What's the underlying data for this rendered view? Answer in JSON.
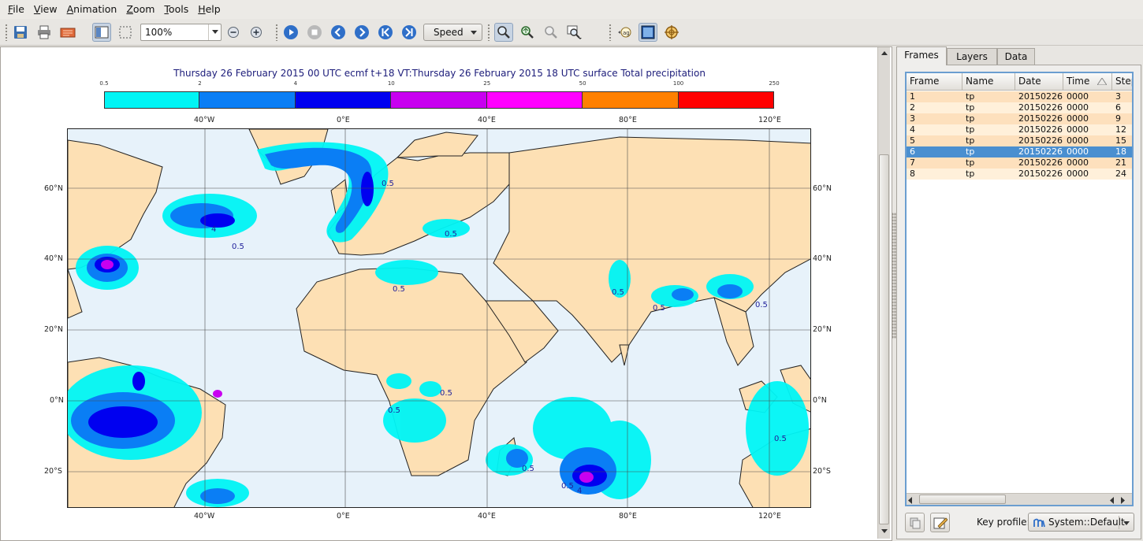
{
  "menu": [
    "File",
    "View",
    "Animation",
    "Zoom",
    "Tools",
    "Help"
  ],
  "toolbar": {
    "zoom_value": "100%",
    "speed_label": "Speed"
  },
  "plot": {
    "title": "Thursday 26 February 2015 00 UTC ecmf t+18 VT:Thursday 26 February 2015 18 UTC surface  Total precipitation",
    "legend": {
      "labels": [
        "0.5",
        "2",
        "4",
        "10",
        "25",
        "50",
        "100",
        "250"
      ],
      "colors": [
        "#00f5f5",
        "#0a7ef5",
        "#0000f0",
        "#c800f0",
        "#ff00ff",
        "#ff8000",
        "#ff0000"
      ]
    },
    "lon_labels": [
      "40°W",
      "0°E",
      "40°E",
      "80°E",
      "120°E"
    ],
    "lat_labels": [
      "60°N",
      "40°N",
      "20°N",
      "0°N",
      "20°S"
    ],
    "contour_labels": [
      "0.5",
      "4"
    ],
    "land_color": "#fde0b4",
    "sea_color": "#e7f2fa"
  },
  "side": {
    "tabs": [
      "Frames",
      "Layers",
      "Data"
    ],
    "columns": [
      "Frame",
      "Name",
      "Date",
      "Time",
      "Step"
    ],
    "rows": [
      {
        "frame": "1",
        "name": "tp",
        "date": "20150226",
        "time": "0000",
        "step": "3"
      },
      {
        "frame": "2",
        "name": "tp",
        "date": "20150226",
        "time": "0000",
        "step": "6"
      },
      {
        "frame": "3",
        "name": "tp",
        "date": "20150226",
        "time": "0000",
        "step": "9"
      },
      {
        "frame": "4",
        "name": "tp",
        "date": "20150226",
        "time": "0000",
        "step": "12"
      },
      {
        "frame": "5",
        "name": "tp",
        "date": "20150226",
        "time": "0000",
        "step": "15"
      },
      {
        "frame": "6",
        "name": "tp",
        "date": "20150226",
        "time": "0000",
        "step": "18"
      },
      {
        "frame": "7",
        "name": "tp",
        "date": "20150226",
        "time": "0000",
        "step": "21"
      },
      {
        "frame": "8",
        "name": "tp",
        "date": "20150226",
        "time": "0000",
        "step": "24"
      }
    ],
    "selected_row": 5,
    "key_profile_label": "Key profile:",
    "key_profile_value": "System::Default"
  }
}
